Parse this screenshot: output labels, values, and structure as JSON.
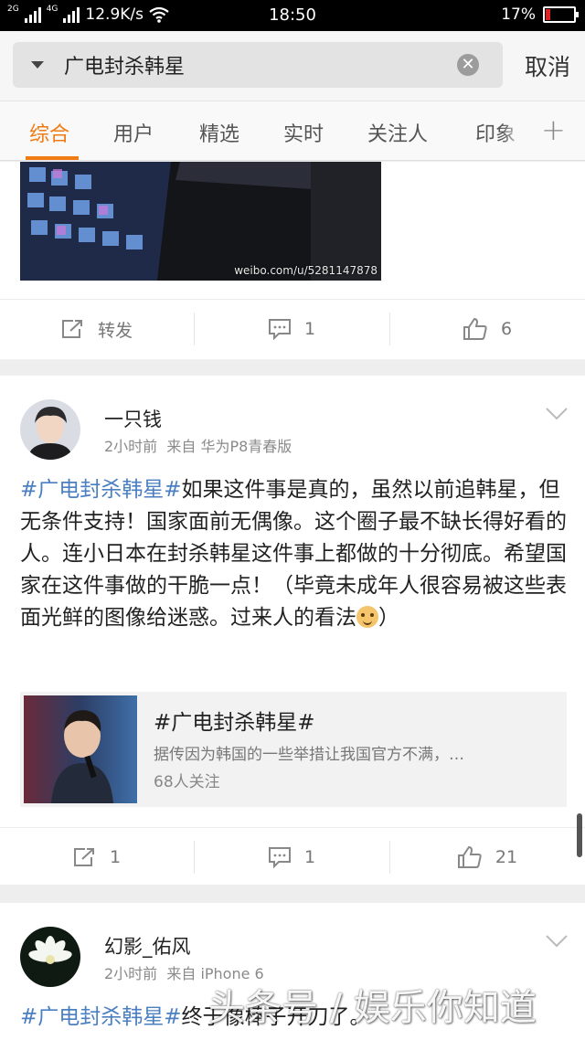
{
  "status_bar": {
    "network_tag_1": "2G",
    "network_tag_2": "4G",
    "speed": "12.9K/s",
    "time": "18:50",
    "battery": "17%",
    "battery_level": 0.17
  },
  "search": {
    "query": "广电封杀韩星",
    "cancel_label": "取消"
  },
  "tabs": [
    "综合",
    "用户",
    "精选",
    "实时",
    "关注人",
    "印象"
  ],
  "tab_active_index": 0,
  "top_image_watermark": "weibo.com/u/5281147878",
  "posts": [
    {
      "actions": {
        "repost": "转发",
        "comment": "1",
        "like": "6"
      }
    },
    {
      "user": "一只钱",
      "time": "2小时前",
      "source": "来自 华为P8青春版",
      "hashtag": "#广电封杀韩星#",
      "text": "如果这件事是真的，虽然以前追韩星，但无条件支持！国家面前无偶像。这个圈子最不缺长得好看的人。连小日本在封杀韩星这件事上都做的十分彻底。希望国家在这件事做的干脆一点！（毕竟未成年人很容易被这些表面光鲜的图像给迷惑。过来人的看法",
      "text_end": "）",
      "topic": {
        "title": "#广电封杀韩星#",
        "desc": "据传因为韩国的一些举措让我国官方不满，…",
        "followers": "68人关注"
      },
      "actions": {
        "repost": "1",
        "comment": "1",
        "like": "21"
      }
    },
    {
      "user": "幻影_佑风",
      "time": "2小时前",
      "source": "来自 iPhone 6",
      "hashtag": "#广电封杀韩星#",
      "text": "终于像棒子开刀了。"
    }
  ],
  "watermark": "头条号 / 娱乐你知道",
  "colors": {
    "accent": "#f07a14",
    "link": "#4a7fc1"
  }
}
